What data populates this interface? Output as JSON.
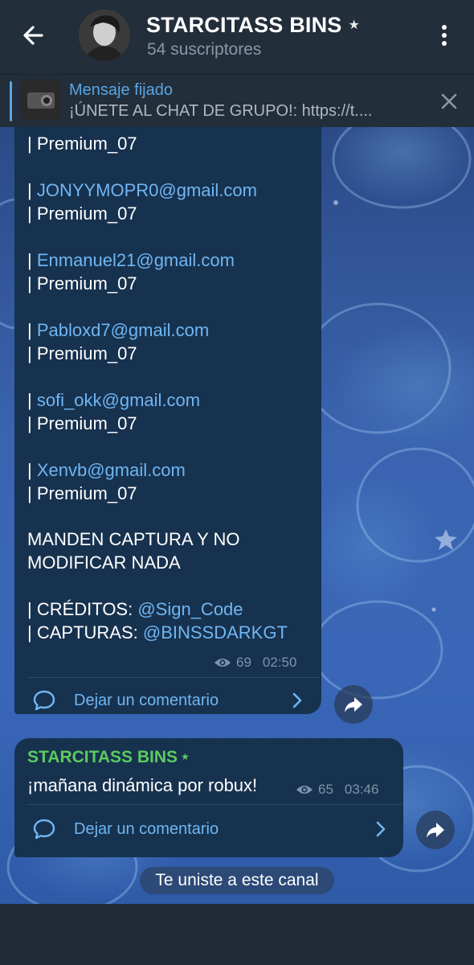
{
  "header": {
    "title": "STARCITASS BINS",
    "title_star": "★",
    "subscribers": "54 suscriptores"
  },
  "pinned": {
    "title": "Mensaje fijado",
    "text": "¡ÚNETE AL CHAT DE GRUPO!: https://t...."
  },
  "message1": {
    "partial_top": "| Premium_07",
    "entries": [
      {
        "email": "JONYYMOPR0@gmail.com",
        "prefix": "| ",
        "plan": "| Premium_07"
      },
      {
        "email": "Enmanuel21@gmail.com",
        "prefix": "| ",
        "plan": " | Premium_07"
      },
      {
        "email": "Pabloxd7@gmail.com",
        "prefix": "| ",
        "plan": " | Premium_07"
      },
      {
        "email": "sofi_okk@gmail.com",
        "prefix": "| ",
        "plan": "| Premium_07"
      },
      {
        "email": "Xenvb@gmail.com",
        "prefix": "| ",
        "plan": "| Premium_07"
      }
    ],
    "note_line1": "MANDEN CAPTURA Y NO",
    "note_line2": "MODIFICAR NADA",
    "credits_label": "| CRÉDITOS: ",
    "credits_link": "@Sign_Code",
    "captures_label": "| CAPTURAS: ",
    "captures_link": "@BINSSDARKGT",
    "views": "69",
    "time": "02:50",
    "comment_label": "Dejar un comentario"
  },
  "message2": {
    "sender": "STARCITASS BINS",
    "sender_star": "★",
    "text": "¡mañana dinámica por robux!",
    "views": "65",
    "time": "03:46",
    "comment_label": "Dejar un comentario"
  },
  "service_message": "Te uniste a este canal",
  "colors": {
    "accent": "#5aa5e3",
    "link": "#6fb6f2",
    "sender": "#5ccb5f",
    "bubble": "#17324f",
    "header": "#222e3a"
  },
  "icons": [
    "back-arrow-icon",
    "more-vert-icon",
    "close-icon",
    "eye-icon",
    "comment-bubble-icon",
    "chevron-right-icon",
    "share-icon"
  ]
}
